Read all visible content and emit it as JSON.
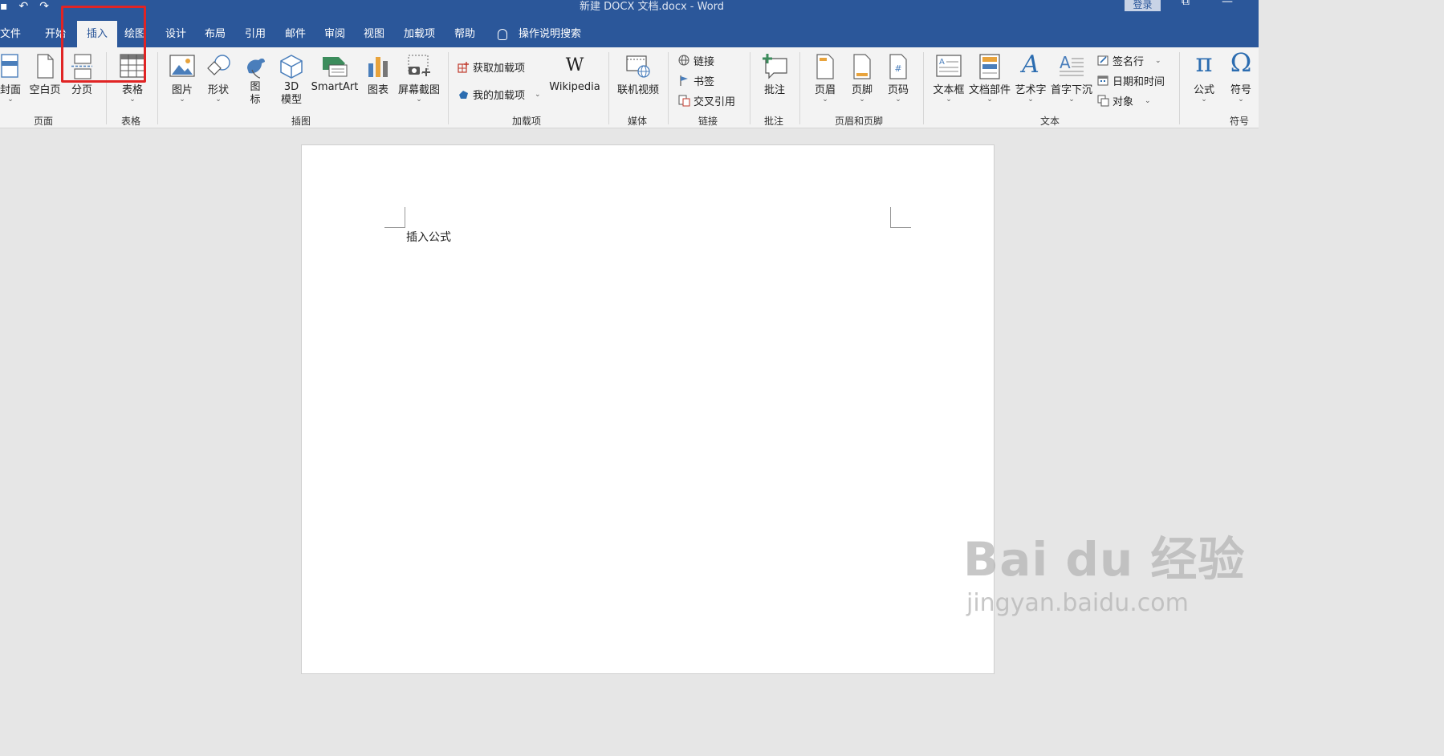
{
  "window": {
    "title": "新建 DOCX 文档.docx  -  Word",
    "login_label": "登录",
    "restore_glyph": "⧉",
    "minimize_glyph": "—"
  },
  "quick_access": [
    "save-icon",
    "undo-icon",
    "redo-icon"
  ],
  "tabs": [
    {
      "label": "文件"
    },
    {
      "label": "开始"
    },
    {
      "label": "插入"
    },
    {
      "label": "绘图"
    },
    {
      "label": "设计"
    },
    {
      "label": "布局"
    },
    {
      "label": "引用"
    },
    {
      "label": "邮件"
    },
    {
      "label": "审阅"
    },
    {
      "label": "视图"
    },
    {
      "label": "加载项"
    },
    {
      "label": "帮助"
    }
  ],
  "tell_me": "操作说明搜索",
  "ribbon": {
    "pages": {
      "group": "页面",
      "cover": "封面",
      "blank": "空白页",
      "break": "分页"
    },
    "tables": {
      "group": "表格",
      "table": "表格"
    },
    "illustrations": {
      "group": "插图",
      "picture": "图片",
      "shapes": "形状",
      "icons_l1": "图",
      "icons_l2": "标",
      "model_l1": "3D",
      "model_l2": "模型",
      "smartart": "SmartArt",
      "chart": "图表",
      "screenshot": "屏幕截图"
    },
    "addins": {
      "group": "加载项",
      "get": "获取加载项",
      "mine": "我的加载项",
      "wiki": "Wikipedia",
      "wiki_glyph": "W"
    },
    "media": {
      "group": "媒体",
      "video": "联机视频"
    },
    "links": {
      "group": "链接",
      "link": "链接",
      "bookmark": "书签",
      "crossref": "交叉引用"
    },
    "comments": {
      "group": "批注",
      "comment": "批注"
    },
    "headerfooter": {
      "group": "页眉和页脚",
      "header": "页眉",
      "footer": "页脚",
      "pagenum": "页码"
    },
    "text": {
      "group": "文本",
      "textbox": "文本框",
      "quickparts": "文档部件",
      "wordart": "艺术字",
      "dropcap": "首字下沉",
      "signature": "签名行",
      "datetime": "日期和时间",
      "object": "对象"
    },
    "symbols": {
      "group": "符号",
      "equation": "公式",
      "equation_glyph": "π",
      "symbol": "符号",
      "symbol_glyph": "Ω"
    }
  },
  "document": {
    "text": "插入公式"
  },
  "watermark": {
    "brand": "Bai du 经验",
    "url": "jingyan.baidu.com"
  },
  "colors": {
    "accent": "#2b579a",
    "highlight": "#e02424"
  }
}
